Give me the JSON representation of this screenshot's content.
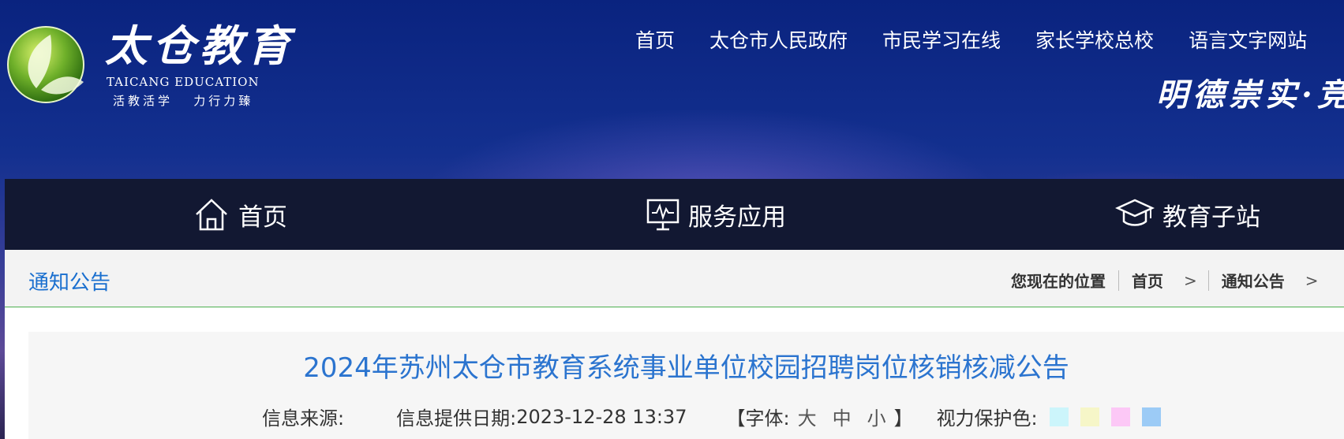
{
  "header": {
    "logo_title": "太仓教育",
    "logo_subtitle": "TAICANG EDUCATION",
    "logo_motto": "活教活学   力行力臻",
    "top_links": [
      "首页",
      "太仓市人民政府",
      "市民学习在线",
      "家长学校总校",
      "语言文字网站"
    ],
    "slogan": "明德崇实·竞先"
  },
  "main_nav": [
    {
      "label": "首页",
      "icon": "home-icon"
    },
    {
      "label": "服务应用",
      "icon": "monitor-icon"
    },
    {
      "label": "教育子站",
      "icon": "graduation-cap-icon"
    }
  ],
  "section": {
    "title": "通知公告"
  },
  "breadcrumb": {
    "label": "您现在的位置",
    "items": [
      "首页",
      "通知公告"
    ],
    "separator": ">"
  },
  "article": {
    "title": "2024年苏州太仓市教育系统事业单位校园招聘岗位核销核减公告",
    "source_label": "信息来源:",
    "date_label": "信息提供日期:",
    "date_value": "2023-12-28 13:37",
    "font_open": "【字体:",
    "font_sizes": [
      "大",
      "中",
      "小"
    ],
    "font_close": "】",
    "eye_label": "视力保护色:",
    "eye_colors": [
      "#ccf5fb",
      "#f6f6c8",
      "#fcc8f6",
      "#9ccbf6"
    ]
  },
  "colors": {
    "accent": "#1a6fcf",
    "nav_bg": "#121832",
    "divider": "#4caf50"
  }
}
